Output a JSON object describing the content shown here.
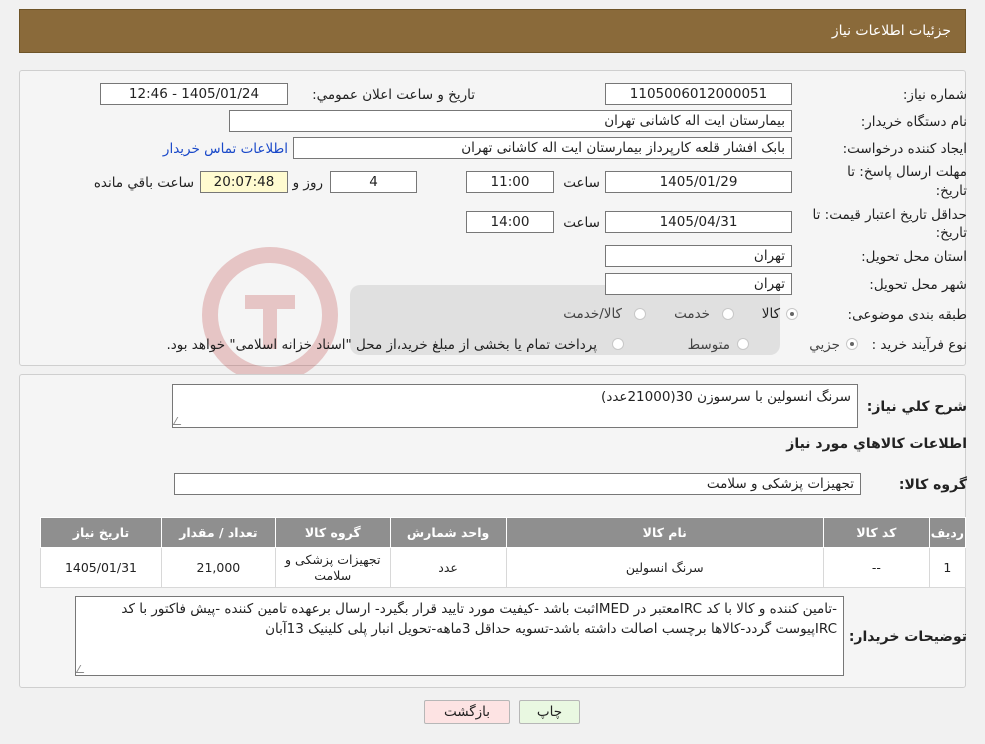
{
  "header": {
    "title": "جزئیات اطلاعات نیاز"
  },
  "info": {
    "need_number_label": "شماره نیاز:",
    "need_number": "1105006012000051",
    "announce_label": "تاریخ و ساعت اعلان عمومي:",
    "announce_value": "1405/01/24 - 12:46",
    "buyer_org_label": "نام دستگاه خریدار:",
    "buyer_org": "بیمارستان ایت اله کاشانی تهران",
    "requester_label": "ایجاد کننده درخواست:",
    "requester": "بابک افشار قلعه کارپرداز بیمارستان ایت اله کاشانی تهران",
    "contact_link": "اطلاعات تماس خریدار",
    "deadline_label_1": "مهلت ارسال پاسخ: تا",
    "deadline_label_2": "تاریخ:",
    "deadline_date": "1405/01/29",
    "time_label": "ساعت",
    "deadline_time": "11:00",
    "days_value": "4",
    "days_label": "روز و",
    "remaining_time": "20:07:48",
    "remaining_label": "ساعت باقي مانده",
    "validity_label_1": "حداقل تاریخ اعتبار قیمت: تا",
    "validity_label_2": "تاریخ:",
    "validity_date": "1405/04/31",
    "validity_time": "14:00",
    "province_label": "استان محل تحویل:",
    "province": "تهران",
    "city_label": "شهر محل تحویل:",
    "city": "تهران",
    "category_label": "طبقه بندی موضوعی:",
    "category_options": [
      "کالا",
      "خدمت",
      "کالا/خدمت"
    ],
    "process_label": "نوع فرآیند خرید :",
    "process_options": [
      "جزیي",
      "متوسط"
    ],
    "process_note": "پرداخت تمام یا بخشی از مبلغ خرید،از محل \"اسناد خزانه اسلامی\" خواهد بود."
  },
  "summary": {
    "label": "شرح کلي نیاز:",
    "value": "سرنگ انسولین با سرسوزن 30(21000عدد)",
    "goods_info_title": "اطلاعات کالاهاي مورد نیاز",
    "group_label": "گروه کالا:",
    "group_value": "تجهیزات پزشکی و سلامت"
  },
  "table": {
    "headers": [
      "ردیف",
      "کد کالا",
      "نام کالا",
      "واحد شمارش",
      "گروه کالا",
      "تعداد / مقدار",
      "تاریخ نیاز"
    ],
    "rows": [
      [
        "1",
        "--",
        "سرنگ انسولین",
        "عدد",
        "تجهیزات پزشکی و سلامت",
        "21,000",
        "1405/01/31"
      ]
    ]
  },
  "notes": {
    "label": "توضیحات خریدار:",
    "value": "-تامین کننده و کالا با کد IRCمعتبر در IMEDثبت باشد -کیفیت مورد تایید قرار بگیرد- ارسال برعهده تامین کننده -پیش فاکتور با کد IRCپیوست گردد-کالاها برچسب اصالت داشته باشد-تسویه حداقل 3ماهه-تحویل انبار پلی کلینیک 13آبان"
  },
  "buttons": {
    "print": "چاپ",
    "back": "بازگشت"
  },
  "colors": {
    "header_bg": "#8a6a3a",
    "print_bg": "#e9f8e1",
    "back_bg": "#fde3e3",
    "link": "#1a49c9"
  }
}
